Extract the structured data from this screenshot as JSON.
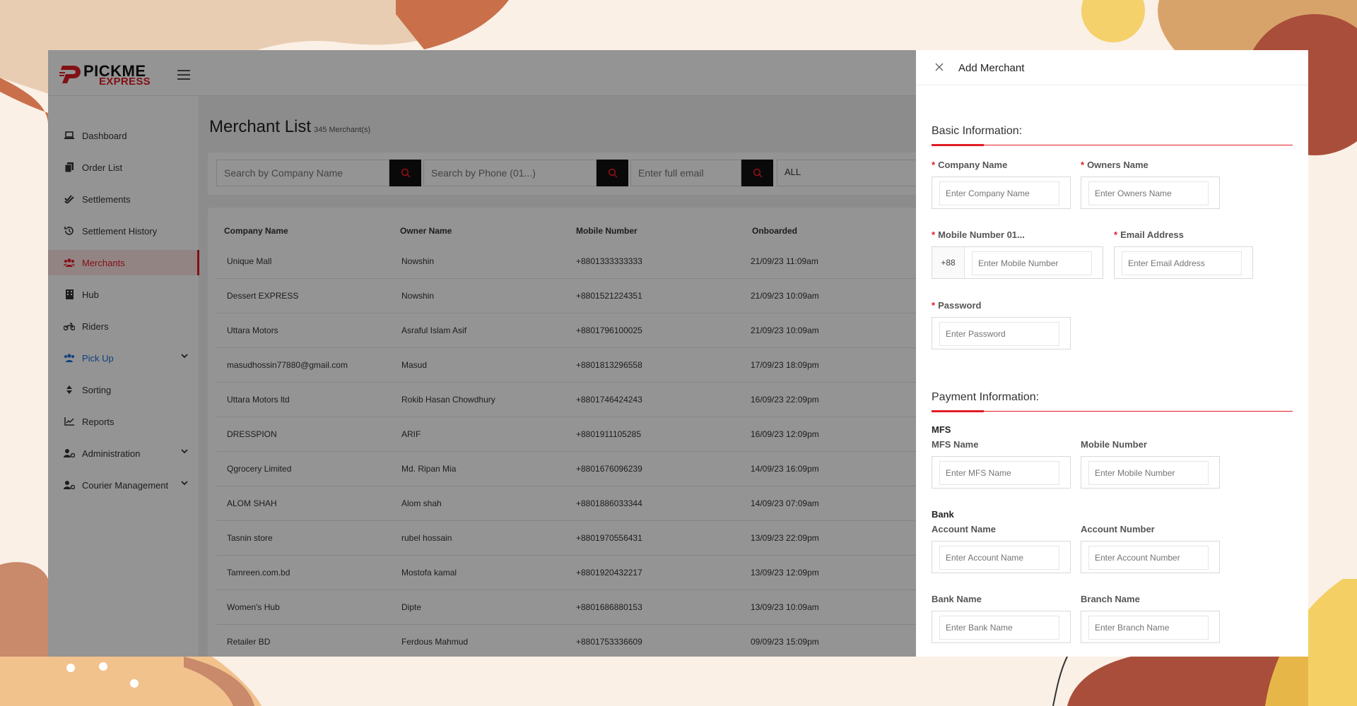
{
  "brand": {
    "name_top": "PICKME",
    "name_bottom": "EXPRESS",
    "accent": "#e11d24"
  },
  "sidebar": {
    "items": [
      {
        "label": "Dashboard",
        "icon": "laptop-icon"
      },
      {
        "label": "Order List",
        "icon": "copy-icon"
      },
      {
        "label": "Settlements",
        "icon": "double-check-icon"
      },
      {
        "label": "Settlement History",
        "icon": "history-icon"
      },
      {
        "label": "Merchants",
        "icon": "users-icon",
        "active": true
      },
      {
        "label": "Hub",
        "icon": "building-icon"
      },
      {
        "label": "Riders",
        "icon": "motorcycle-icon"
      },
      {
        "label": "Pick Up",
        "icon": "users-icon",
        "expandable": true
      },
      {
        "label": "Sorting",
        "icon": "sort-icon"
      },
      {
        "label": "Reports",
        "icon": "chart-line-icon"
      },
      {
        "label": "Administration",
        "icon": "user-gear-icon",
        "expandable": true
      },
      {
        "label": "Courier Management",
        "icon": "user-gear-icon",
        "expandable": true
      }
    ]
  },
  "main": {
    "title": "Merchant List",
    "count": "345 Merchant(s)",
    "filters": {
      "company_placeholder": "Search by Company Name",
      "phone_placeholder": "Search by Phone (01...)",
      "email_placeholder": "Enter full email",
      "status_value": "ALL"
    },
    "columns": [
      "Company Name",
      "Owner Name",
      "Mobile Number",
      "Onboarded"
    ],
    "rows": [
      [
        "Unique Mall",
        "Nowshin",
        "+8801333333333",
        "21/09/23 11:09am"
      ],
      [
        "Dessert EXPRESS",
        "Nowshin",
        "+8801521224351",
        "21/09/23 10:09am"
      ],
      [
        "Uttara Motors",
        "Asraful Islam Asif",
        "+8801796100025",
        "21/09/23 10:09am"
      ],
      [
        "masudhossin77880@gmail.com",
        "Masud",
        "+8801813296558",
        "17/09/23 18:09pm"
      ],
      [
        "Uttara Motors ltd",
        "Rokib Hasan Chowdhury",
        "+8801746424243",
        "16/09/23 22:09pm"
      ],
      [
        "DRESSPION",
        "ARIF",
        "+8801911105285",
        "16/09/23 12:09pm"
      ],
      [
        "Qgrocery Limited",
        "Md. Ripan Mia",
        "+8801676096239",
        "14/09/23 16:09pm"
      ],
      [
        "ALOM SHAH",
        "Alom shah",
        "+8801886033344",
        "14/09/23 07:09am"
      ],
      [
        "Tasnin store",
        "rubel hossain",
        "+8801970556431",
        "13/09/23 22:09pm"
      ],
      [
        "Tamreen.com.bd",
        "Mostofa kamal",
        "+8801920432217",
        "13/09/23 12:09pm"
      ],
      [
        "Women's Hub",
        "Dipte",
        "+8801686880153",
        "13/09/23 10:09am"
      ],
      [
        "Retailer BD",
        "Ferdous Mahmud",
        "+8801753336609",
        "09/09/23 15:09pm"
      ]
    ]
  },
  "drawer": {
    "title": "Add Merchant",
    "basic_title": "Basic Information:",
    "company_label": "Company Name",
    "company_placeholder": "Enter Company Name",
    "owners_label": "Owners Name",
    "owners_placeholder": "Enter Owners Name",
    "mobile_label": "Mobile Number 01...",
    "mobile_prefix": "+88",
    "mobile_placeholder": "Enter Mobile Number",
    "email_label": "Email Address",
    "email_placeholder": "Enter Email Address",
    "password_label": "Password",
    "password_placeholder": "Enter Password",
    "payment_title": "Payment Information:",
    "mfs_heading": "MFS",
    "mfs_name_label": "MFS Name",
    "mfs_name_placeholder": "Enter MFS Name",
    "mfs_mobile_label": "Mobile Number",
    "mfs_mobile_placeholder": "Enter Mobile Number",
    "bank_heading": "Bank",
    "account_name_label": "Account Name",
    "account_name_placeholder": "Enter Account Name",
    "account_number_label": "Account Number",
    "account_number_placeholder": "Enter Account Number",
    "bank_name_label": "Bank Name",
    "bank_name_placeholder": "Enter Bank Name",
    "branch_name_label": "Branch Name",
    "branch_name_placeholder": "Enter Branch Name"
  }
}
